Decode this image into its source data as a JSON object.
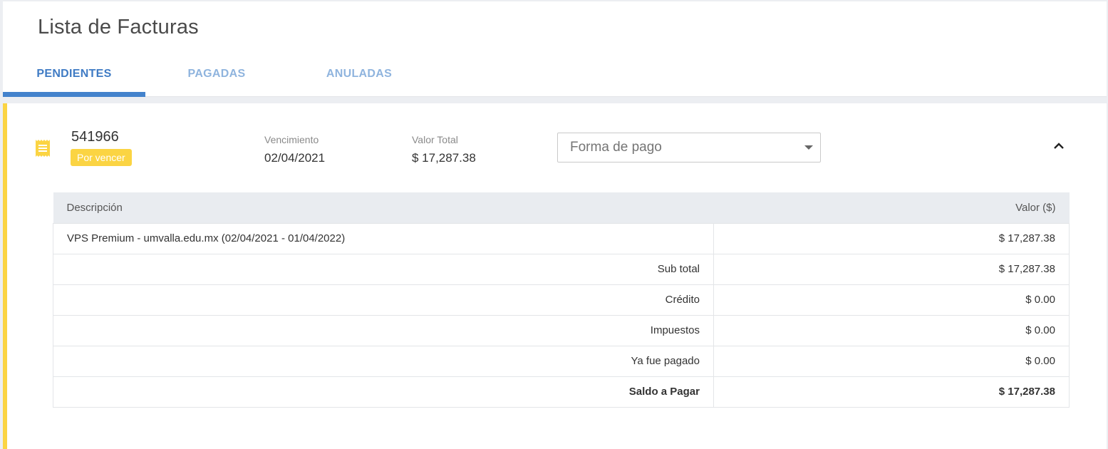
{
  "page": {
    "title": "Lista de Facturas"
  },
  "tabs": [
    {
      "label": "PENDIENTES",
      "active": true
    },
    {
      "label": "PAGADAS",
      "active": false
    },
    {
      "label": "ANULADAS",
      "active": false
    }
  ],
  "invoice": {
    "number": "541966",
    "status": "Por vencer",
    "due_label": "Vencimiento",
    "due_date": "02/04/2021",
    "total_label": "Valor Total",
    "total_value": "$ 17,287.38",
    "payment_placeholder": "Forma de pago"
  },
  "table": {
    "headers": {
      "description": "Descripción",
      "value": "Valor ($)"
    },
    "item": {
      "description": "VPS Premium - umvalla.edu.mx (02/04/2021 - 01/04/2022)",
      "value": "$ 17,287.38"
    },
    "summary": [
      {
        "label": "Sub total",
        "value": "$ 17,287.38"
      },
      {
        "label": "Crédito",
        "value": "$ 0.00"
      },
      {
        "label": "Impuestos",
        "value": "$ 0.00"
      },
      {
        "label": "Ya fue pagado",
        "value": "$ 0.00"
      },
      {
        "label": "Saldo a Pagar",
        "value": "$ 17,287.38"
      }
    ]
  },
  "colors": {
    "accent_blue": "#4382cc",
    "tab_inactive": "#8fb4de",
    "status_yellow": "#fbd443"
  },
  "icons": [
    "invoice-icon",
    "caret-down-icon",
    "chevron-up-icon"
  ]
}
